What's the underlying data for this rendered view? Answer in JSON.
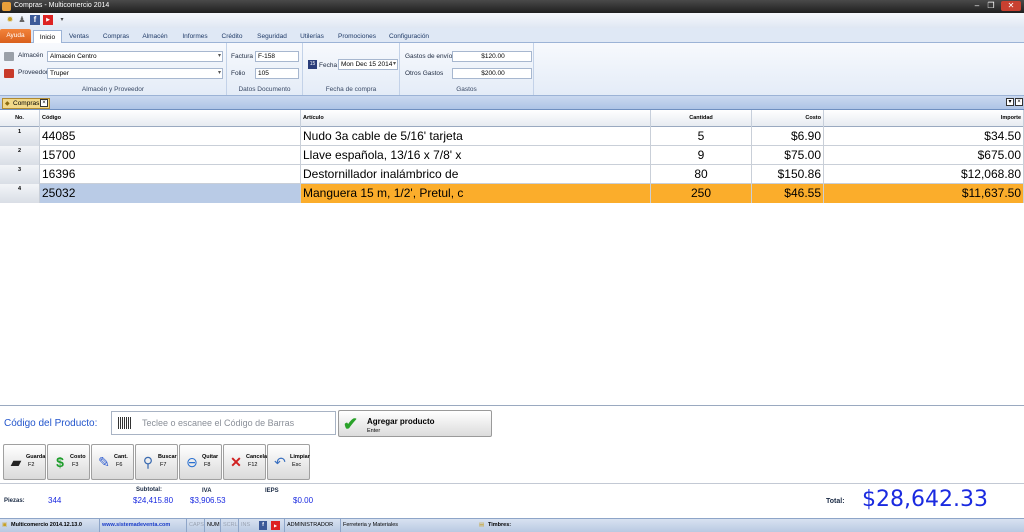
{
  "window": {
    "title": "Compras - Multicomercio 2014"
  },
  "tabs": [
    "Ayuda",
    "Inicio",
    "Ventas",
    "Compras",
    "Almacén",
    "Informes",
    "Crédito",
    "Seguridad",
    "Utilerías",
    "Promociones",
    "Configuración"
  ],
  "ribbon": {
    "almacen_label": "Almacén",
    "almacen_value": "Almacén Centro",
    "proveedor_label": "Proveedor",
    "proveedor_value": "Truper",
    "group1_caption": "Almacén y Proveedor",
    "factura_label": "Factura",
    "factura_value": "F-158",
    "folio_label": "Folio",
    "folio_value": "105",
    "group2_caption": "Datos Documento",
    "fecha_label": "Fecha",
    "fecha_value": "Mon Dec 15 2014",
    "group3_caption": "Fecha de compra",
    "envio_label": "Gastos de envío",
    "envio_value": "$120.00",
    "otros_label": "Otros Gastos",
    "otros_value": "$200.00",
    "group4_caption": "Gastos"
  },
  "doc_tab": {
    "label": "Compras"
  },
  "table": {
    "headers": [
      "No.",
      "Código",
      "Artículo",
      "Cantidad",
      "Costo",
      "Importe"
    ],
    "rows": [
      {
        "no": "1",
        "codigo": "44085",
        "articulo": "Nudo 3a cable de 5/16' tarjeta",
        "cantidad": "5",
        "costo": "$6.90",
        "importe": "$34.50"
      },
      {
        "no": "2",
        "codigo": "15700",
        "articulo": "Llave española, 13/16 x 7/8' x",
        "cantidad": "9",
        "costo": "$75.00",
        "importe": "$675.00"
      },
      {
        "no": "3",
        "codigo": "16396",
        "articulo": "Destornillador inalámbrico de",
        "cantidad": "80",
        "costo": "$150.86",
        "importe": "$12,068.80"
      },
      {
        "no": "4",
        "codigo": "25032",
        "articulo": "Manguera 15 m, 1/2', Pretul, c",
        "cantidad": "250",
        "costo": "$46.55",
        "importe": "$11,637.50"
      }
    ]
  },
  "product_entry": {
    "label": "Código del Producto:",
    "placeholder": "Teclee o escanee el Código de Barras",
    "add_label": "Agregar producto",
    "add_key": "Enter"
  },
  "actions": [
    {
      "label": "Guarda",
      "key": "F2",
      "icon": "save-icon"
    },
    {
      "label": "Costo",
      "key": "F3",
      "icon": "dollar-icon"
    },
    {
      "label": "Cant.",
      "key": "F6",
      "icon": "pencil-icon"
    },
    {
      "label": "Buscar",
      "key": "F7",
      "icon": "magnifier-icon"
    },
    {
      "label": "Quitar",
      "key": "F8",
      "icon": "minus-icon"
    },
    {
      "label": "Cancela",
      "key": "F12",
      "icon": "cross-icon"
    },
    {
      "label": "Limpiar",
      "key": "Esc",
      "icon": "undo-icon"
    }
  ],
  "totals": {
    "piezas_label": "Piezas:",
    "piezas_value": "344",
    "subtotal_label": "Subtotal:",
    "subtotal_value": "$24,415.80",
    "iva_label": "IVA",
    "iva_value": "$3,906.53",
    "ieps_label": "IEPS",
    "ieps_value": "$0.00",
    "total_label": "Total:",
    "total_value": "$28,642.33"
  },
  "statusbar": {
    "version": "Multicomercio 2014.12.13.0",
    "website": "www.sistemadeventa.com",
    "caps": "CAPS",
    "num": "NUM",
    "scrl": "SCRL",
    "ins": "INS",
    "user": "ADMINISTRADOR",
    "business": "Ferreteria y Materiales",
    "timbres": "Timbres:"
  },
  "colors": {
    "accent_orange": "#fbad2b",
    "total_blue": "#1a2ae0",
    "label_blue": "#2255cc"
  }
}
